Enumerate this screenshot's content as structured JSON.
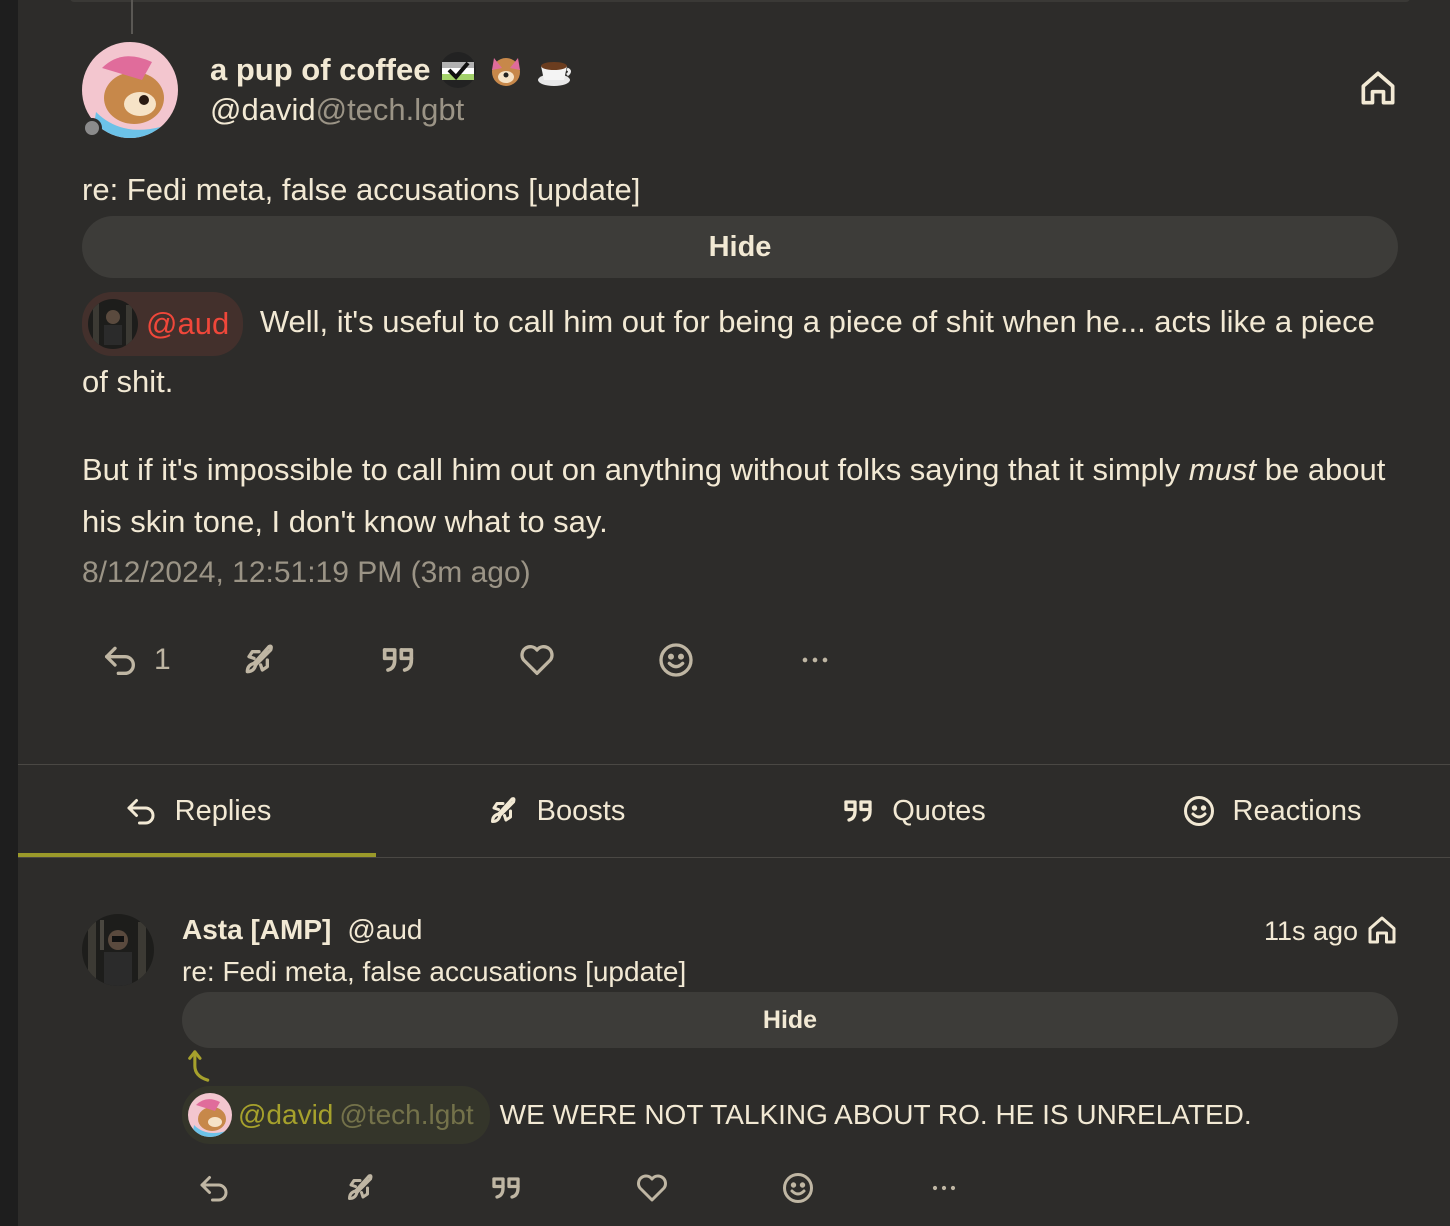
{
  "post": {
    "display_name": "a pup of coffee",
    "handle_user": "@david",
    "handle_host": "@tech.lgbt",
    "content_warning": "re: Fedi meta, false accusations [update]",
    "hide_label": "Hide",
    "mention": "@aud",
    "body_p1": "Well, it's useful to call him out for being a piece of shit when he... acts like a piece of shit.",
    "body_p2_a": "But if it's impossible to call him out on anything without folks saying that it simply ",
    "body_p2_em": "must",
    "body_p2_b": " be about his skin tone, I don't know what to say.",
    "timestamp": "8/12/2024, 12:51:19 PM (3m ago)",
    "reply_count": "1",
    "icons": [
      "reply-icon",
      "boost-rocket-icon",
      "quote-icon",
      "heart-icon",
      "emoji-reaction-icon",
      "more-icon"
    ]
  },
  "tabs": [
    {
      "label": "Replies",
      "icon": "reply-icon",
      "active": true
    },
    {
      "label": "Boosts",
      "icon": "boost-rocket-icon",
      "active": false
    },
    {
      "label": "Quotes",
      "icon": "quote-icon",
      "active": false
    },
    {
      "label": "Reactions",
      "icon": "emoji-reaction-icon",
      "active": false
    }
  ],
  "reply": {
    "display_name": "Asta [AMP]",
    "handle": "@aud",
    "time": "11s ago",
    "content_warning": "re: Fedi meta, false accusations [update]",
    "hide_label": "Hide",
    "mention_user": "@david",
    "mention_host": "@tech.lgbt",
    "body": "WE WERE NOT TALKING ABOUT RO.  HE IS UNRELATED."
  },
  "colors": {
    "background": "#2d2c2a",
    "text": "#f2e9d4",
    "muted": "#9b9486",
    "mention_red": "#f0473a",
    "accent_olive": "#9b9a2a"
  }
}
